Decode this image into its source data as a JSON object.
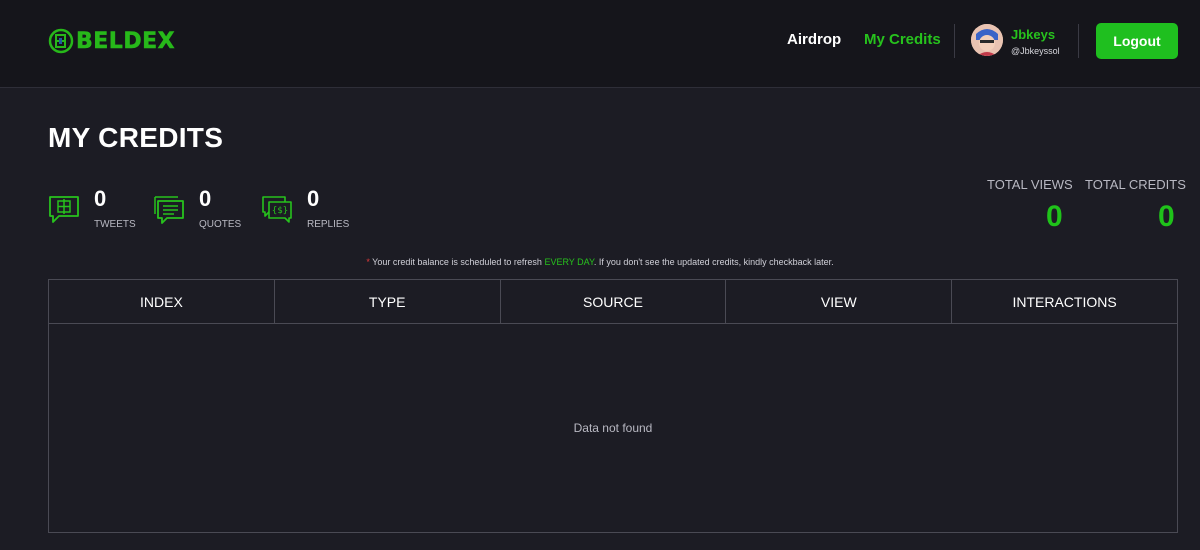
{
  "brand": {
    "name": "BELDEX",
    "accent": "#27c21d"
  },
  "nav": {
    "airdrop": "Airdrop",
    "my_credits": "My Credits"
  },
  "user": {
    "name": "Jbkeys",
    "handle": "@Jbkeyssol"
  },
  "header": {
    "logout": "Logout"
  },
  "page": {
    "title": "MY CREDITS"
  },
  "stats": {
    "tweets": {
      "value": "0",
      "label": "TWEETS",
      "icon": "tweet-credit-icon"
    },
    "quotes": {
      "value": "0",
      "label": "QUOTES",
      "icon": "quote-credit-icon"
    },
    "replies": {
      "value": "0",
      "label": "REPLIES",
      "icon": "reply-credit-icon"
    }
  },
  "totals": {
    "views_label": "TOTAL VIEWS",
    "views_value": "0",
    "credits_label": "TOTAL CREDITS",
    "credits_value": "0"
  },
  "notice": {
    "star": "*",
    "before": " Your credit balance is scheduled to refresh ",
    "highlight": "EVERY DAY",
    "after": ". If you don't see the updated credits, kindly checkback later."
  },
  "table": {
    "columns": [
      "INDEX",
      "TYPE",
      "SOURCE",
      "VIEW",
      "INTERACTIONS"
    ],
    "rows": [],
    "empty_text": "Data not found"
  }
}
